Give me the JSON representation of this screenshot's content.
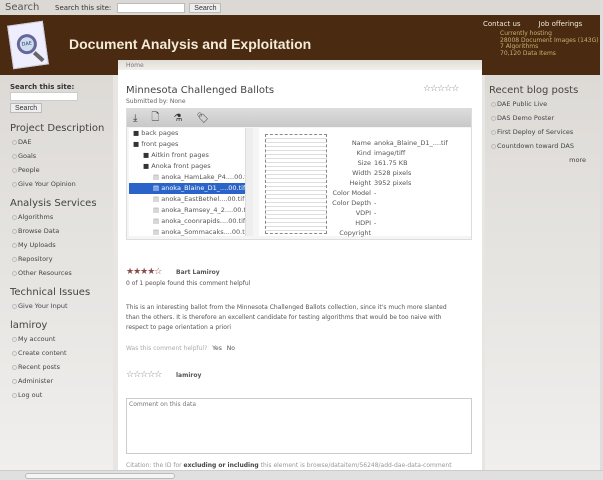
{
  "topbar": {
    "title": "Search",
    "label": "Search this site:",
    "button": "Search"
  },
  "header": {
    "site_title": "Document Analysis and Exploitation",
    "logo_text": "DAE",
    "links": [
      "Contact us",
      "Job offerings"
    ],
    "stats": [
      "Currently hosting",
      "28008 Document Images (143G)",
      "7 Algorithms",
      "70,120 Data Items"
    ]
  },
  "left": {
    "search_label": "Search this site:",
    "search_button": "Search",
    "sections": [
      {
        "title": "Project Description",
        "items": [
          "DAE",
          "Goals",
          "People",
          "Give Your Opinion"
        ]
      },
      {
        "title": "Analysis Services",
        "items": [
          "Algorithms",
          "Browse Data",
          "My Uploads",
          "Repository",
          "Other Resources"
        ]
      },
      {
        "title": "Technical Issues",
        "items": [
          "Give Your Input"
        ]
      },
      {
        "title": "lamiroy",
        "items": [
          "My account",
          "Create content",
          "Recent posts",
          "Administer",
          "Log out"
        ]
      }
    ]
  },
  "main": {
    "breadcrumb": "Home",
    "title": "Minnesota Challenged Ballots",
    "submitted": "Submitted by: None",
    "rating": 0,
    "tree": [
      {
        "label": "back pages",
        "type": "folder",
        "level": 0
      },
      {
        "label": "front pages",
        "type": "folder",
        "level": 0
      },
      {
        "label": "Aitkin front pages",
        "type": "folder",
        "level": 1
      },
      {
        "label": "Anoka front pages",
        "type": "folder",
        "level": 1
      },
      {
        "label": "anoka_HamLake_P4....00.t",
        "type": "file",
        "level": 2
      },
      {
        "label": "anoka_Blaine_D1_....00.tif",
        "type": "file",
        "level": 2,
        "selected": true
      },
      {
        "label": "anoka_EastBethel....00.tif",
        "type": "file",
        "level": 2
      },
      {
        "label": "anoka_Ramsey_4_2....00.tif",
        "type": "file",
        "level": 2
      },
      {
        "label": "anoka_coonrapids....00.tif",
        "type": "file",
        "level": 2
      },
      {
        "label": "anoka_Sommacaks....00.tif",
        "type": "file",
        "level": 2
      }
    ],
    "meta": [
      [
        "Name",
        "anoka_Blaine_D1_....tif"
      ],
      [
        "Kind",
        "image/tiff"
      ],
      [
        "Size",
        "161.75 KB"
      ],
      [
        "Width",
        "2528 pixels"
      ],
      [
        "Height",
        "3952 pixels"
      ],
      [
        "Color Model",
        "-"
      ],
      [
        "Color Depth",
        "-"
      ],
      [
        "VDPI",
        "-"
      ],
      [
        "HDPI",
        "-"
      ],
      [
        "Copyright",
        ""
      ]
    ],
    "review": {
      "author": "Bart Lamiroy",
      "rating": 4,
      "helpful": "0 of 1 people found this comment helpful",
      "text": "This is an interesting ballot from the Minnesota Challenged Ballots collection, since it's much more slanted than the others. It is therefore an excellent candidate for testing algorithms that would be too naive with respect to page orientation a priori",
      "question": "Was this comment helpful?",
      "yes": "Yes",
      "no": "No"
    },
    "new_review": {
      "author": "lamiroy",
      "rating": 0,
      "placeholder": "Comment on this data"
    },
    "citation_pre": "Citation: the ID for",
    "citation_bold": "excluding or including",
    "citation_post": "this element is browse/dataitem/56248/add-dae-data-comment"
  },
  "right": {
    "title": "Recent blog posts",
    "items": [
      "DAE Public Live",
      "DAS Demo Poster",
      "First Deploy of Services",
      "Countdown toward DAS"
    ],
    "more": "more"
  }
}
